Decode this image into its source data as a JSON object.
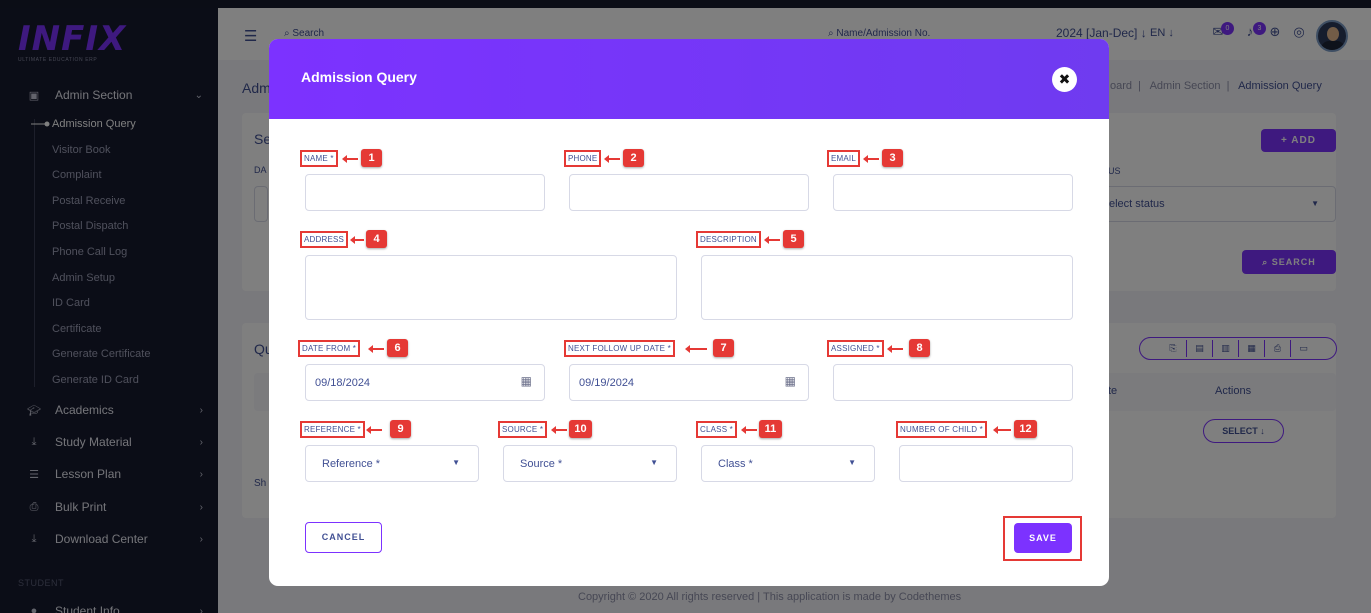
{
  "app": {
    "logo_text": "INFIX",
    "logo_subtitle": "ULTIMATE EDUCATION ERP"
  },
  "sidebar": {
    "sections": [
      {
        "label": "Admin Section",
        "icon": "admin-icon",
        "chevron": "⌄"
      },
      {
        "label": "Academics",
        "icon": "graduation-cap-icon",
        "chevron": "›"
      },
      {
        "label": "Study Material",
        "icon": "download-icon",
        "chevron": "›"
      },
      {
        "label": "Lesson Plan",
        "icon": "list-icon",
        "chevron": "›"
      },
      {
        "label": "Bulk Print",
        "icon": "printer-icon",
        "chevron": "›"
      },
      {
        "label": "Download Center",
        "icon": "download-icon",
        "chevron": "›"
      },
      {
        "label": "Student Info",
        "icon": "user-icon",
        "chevron": "›"
      }
    ],
    "admin_items": [
      "Admission Query",
      "Visitor Book",
      "Complaint",
      "Postal Receive",
      "Postal Dispatch",
      "Phone Call Log",
      "Admin Setup",
      "ID Card",
      "Certificate",
      "Generate Certificate",
      "Generate ID Card"
    ],
    "active_item": "Admission Query",
    "student_caption": "STUDENT"
  },
  "header": {
    "search_placeholder": "Search",
    "search2_placeholder": "Name/Admission No.",
    "session": "2024 [Jan-Dec] ↓",
    "language": "EN ↓",
    "messages_count": "0",
    "notifications_count": "3"
  },
  "page": {
    "title_fragment": "Adm",
    "breadcrumb_parts": [
      "oard",
      "Admin Section",
      "Admission Query"
    ],
    "add_button": "+ ADD",
    "status_label": "US",
    "status_placeholder": "elect status",
    "search_button": "SEARCH",
    "section_frag_1": "Se",
    "section_frag_2": "DA",
    "section_frag_3": "Qu",
    "section_frag_4": "Sh",
    "col_date_fragment": "te",
    "col_actions": "Actions",
    "select_button": "SELECT ↓",
    "footer": "Copyright © 2020 All rights reserved | This application is made by Codethemes"
  },
  "modal": {
    "title": "Admission Query",
    "close_symbol": "✖",
    "fields": {
      "name": {
        "label": "NAME *",
        "value": ""
      },
      "phone": {
        "label": "PHONE",
        "value": ""
      },
      "email": {
        "label": "EMAIL",
        "value": ""
      },
      "address": {
        "label": "ADDRESS",
        "value": ""
      },
      "description": {
        "label": "DESCRIPTION",
        "value": ""
      },
      "date_from": {
        "label": "DATE FROM *",
        "value": "09/18/2024"
      },
      "next_follow_up_date": {
        "label": "NEXT FOLLOW UP DATE *",
        "value": "09/19/2024"
      },
      "assigned": {
        "label": "ASSIGNED *",
        "value": ""
      },
      "reference": {
        "label": "REFERENCE *",
        "placeholder": "Reference *"
      },
      "source": {
        "label": "SOURCE *",
        "placeholder": "Source *"
      },
      "class": {
        "label": "CLASS *",
        "placeholder": "Class *"
      },
      "number_of_child": {
        "label": "NUMBER OF CHILD *",
        "value": ""
      }
    },
    "annotations": [
      "1",
      "2",
      "3",
      "4",
      "5",
      "6",
      "7",
      "8",
      "9",
      "10",
      "11",
      "12"
    ],
    "cancel_label": "CANCEL",
    "save_label": "SAVE"
  },
  "colors": {
    "accent": "#7c32ff",
    "annotation_red": "#e53935",
    "sidebar_bg": "#161a2e",
    "text_primary": "#415094"
  }
}
